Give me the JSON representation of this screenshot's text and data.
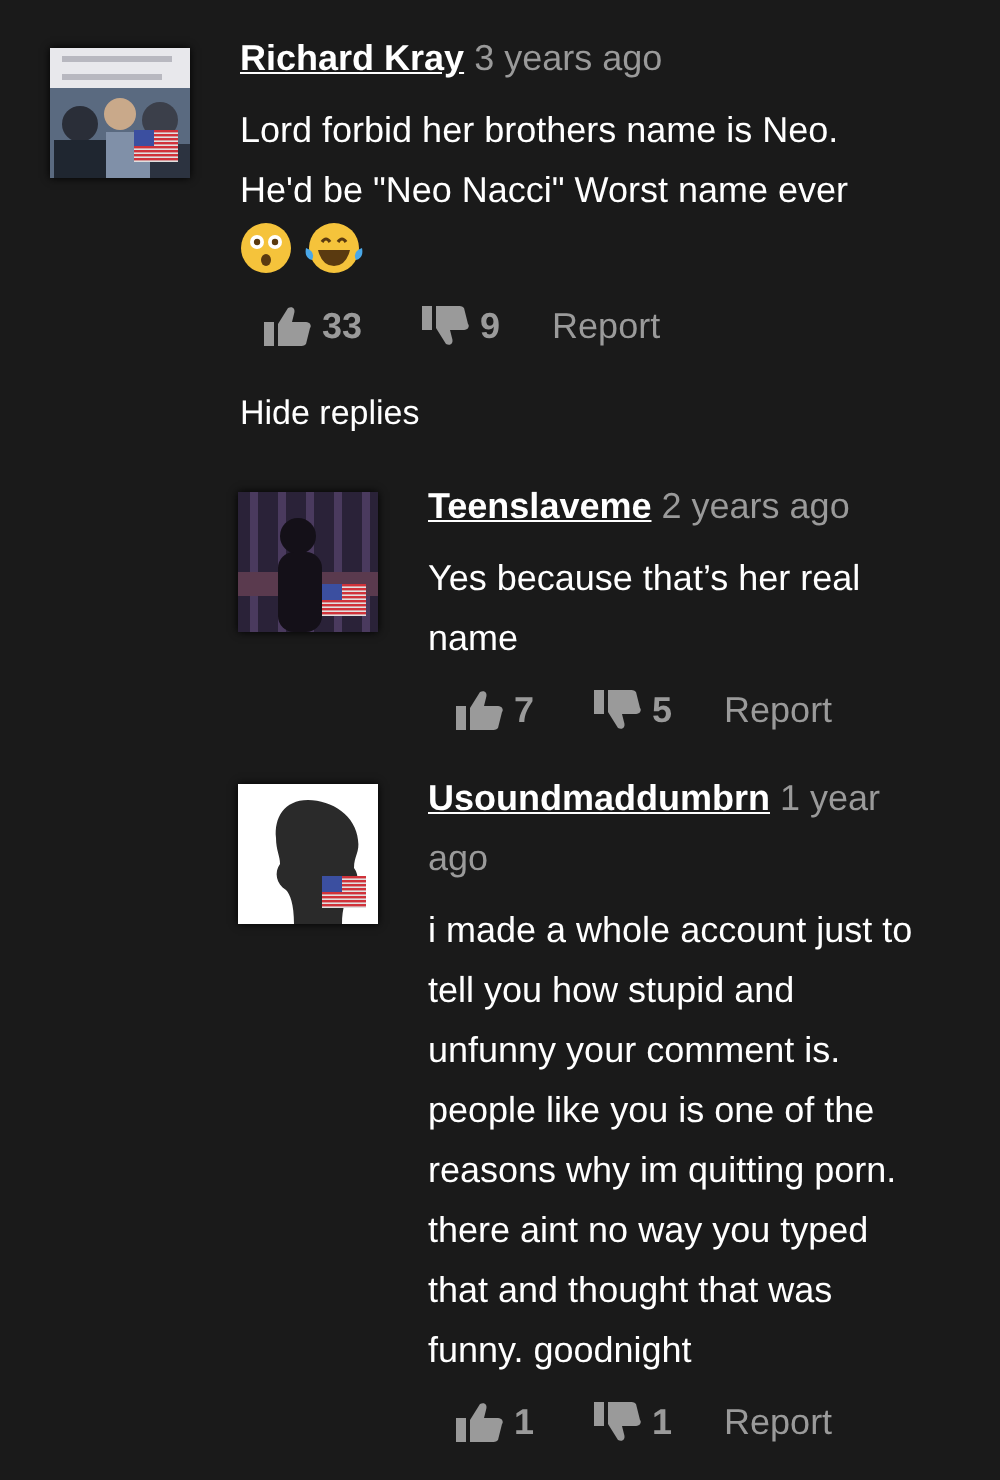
{
  "comment": {
    "author": "Richard Kray",
    "time": "3 years ago",
    "avatar": {
      "kind": "picture",
      "flag": true
    },
    "body": "Lord forbid her brothers name is Neo. He'd be \"Neo Nacci\" Worst name ever",
    "emojis": [
      {
        "kind": "astonished"
      },
      {
        "kind": "tears-of-joy"
      }
    ],
    "likes": "33",
    "dislikes": "9",
    "report": "Report"
  },
  "hide_replies": "Hide replies",
  "replies": [
    {
      "author": "Teenslaveme",
      "time": "2 years ago",
      "avatar": {
        "kind": "picture",
        "flag": true
      },
      "body": "Yes because that’s her real name",
      "likes": "7",
      "dislikes": "5",
      "report": "Report"
    },
    {
      "author": "Usoundmaddumbrn",
      "time": "1 year ago",
      "avatar": {
        "kind": "silhouette",
        "flag": true
      },
      "body": "i made a whole account just to tell you how stupid and unfunny your comment is. people like you is one of the reasons why im quitting porn. there aint no way you typed that and thought that was funny. goodnight",
      "likes": "1",
      "dislikes": "1",
      "report": "Report"
    }
  ]
}
